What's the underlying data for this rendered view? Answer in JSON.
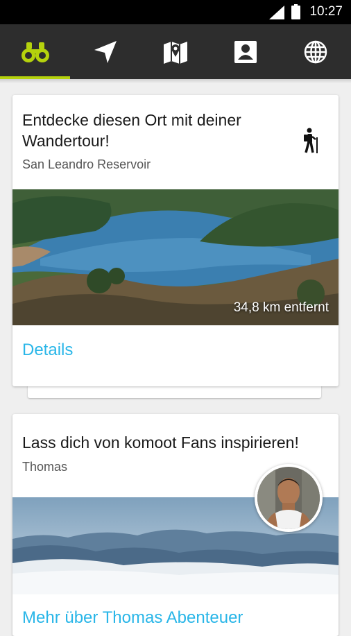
{
  "status_bar": {
    "time": "10:27",
    "icons": [
      "signal-icon",
      "battery-icon"
    ]
  },
  "nav": {
    "tabs": [
      {
        "icon": "binoculars-icon",
        "active": true
      },
      {
        "icon": "navigation-arrow-icon",
        "active": false
      },
      {
        "icon": "map-pin-icon",
        "active": false
      },
      {
        "icon": "profile-icon",
        "active": false
      },
      {
        "icon": "globe-icon",
        "active": false
      }
    ],
    "accent_color": "#b5d20d",
    "background_color": "#2d2d2d"
  },
  "card1": {
    "title_line1": "Entdecke diesen Ort mit deiner",
    "title_line2": "Wandertour!",
    "subtitle": "San Leandro Reservoir",
    "activity_icon": "hiker-icon",
    "distance": "34,8 km entfernt",
    "link": "Details"
  },
  "card2": {
    "title": "Lass dich von komoot Fans inspirieren!",
    "subtitle": "Thomas",
    "link": "Mehr über Thomas Abenteuer"
  },
  "link_color": "#29b6e8"
}
